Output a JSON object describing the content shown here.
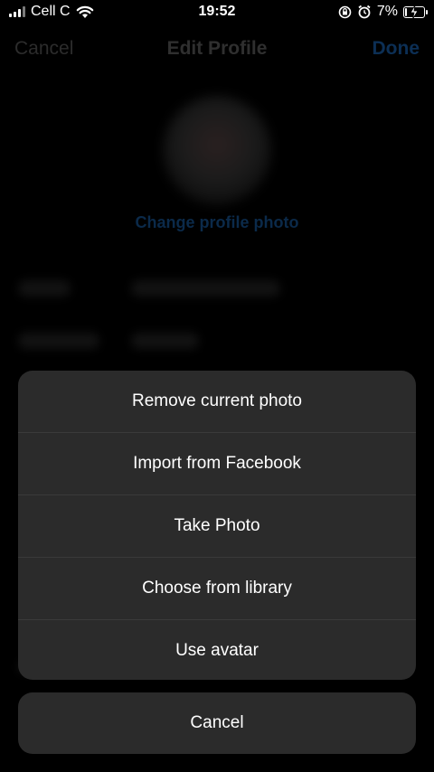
{
  "status_bar": {
    "carrier": "Cell C",
    "time": "19:52",
    "battery_percent": "7%",
    "battery_level": 0.07,
    "icons": [
      "signal-icon",
      "wifi-icon",
      "orientation-lock-icon",
      "alarm-icon",
      "battery-charging-icon"
    ]
  },
  "nav": {
    "cancel_label": "Cancel",
    "title": "Edit Profile",
    "done_label": "Done"
  },
  "profile": {
    "change_photo_label": "Change profile photo"
  },
  "action_sheet": {
    "items": [
      {
        "label": "Remove current photo"
      },
      {
        "label": "Import from Facebook"
      },
      {
        "label": "Take Photo"
      },
      {
        "label": "Choose from library"
      },
      {
        "label": "Use avatar"
      }
    ],
    "cancel_label": "Cancel"
  },
  "colors": {
    "sheet_bg": "#2b2b2b",
    "done_blue": "#0c2f55"
  }
}
